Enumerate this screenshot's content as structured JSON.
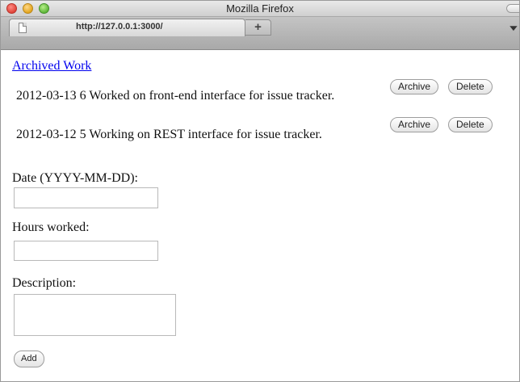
{
  "window": {
    "title": "Mozilla Firefox"
  },
  "tabs": {
    "active_label": "http://127.0.0.1:3000/",
    "new_tab_label": "+",
    "list_label": "▼"
  },
  "page": {
    "archived_link": "Archived Work",
    "entries": [
      {
        "text": "2012-03-13 6 Worked on front-end interface for issue tracker.",
        "archive_label": "Archive",
        "delete_label": "Delete"
      },
      {
        "text": "2012-03-12 5 Working on REST interface for issue tracker.",
        "archive_label": "Archive",
        "delete_label": "Delete"
      }
    ],
    "form": {
      "date_label": "Date (YYYY-MM-DD):",
      "date_value": "",
      "hours_label": "Hours worked:",
      "hours_value": "",
      "description_label": "Description:",
      "description_value": "",
      "add_label": "Add"
    }
  },
  "colors": {
    "link": "#0000ee",
    "close": "#e0443a",
    "minimize": "#e3a51e",
    "zoom": "#5fb73a"
  }
}
